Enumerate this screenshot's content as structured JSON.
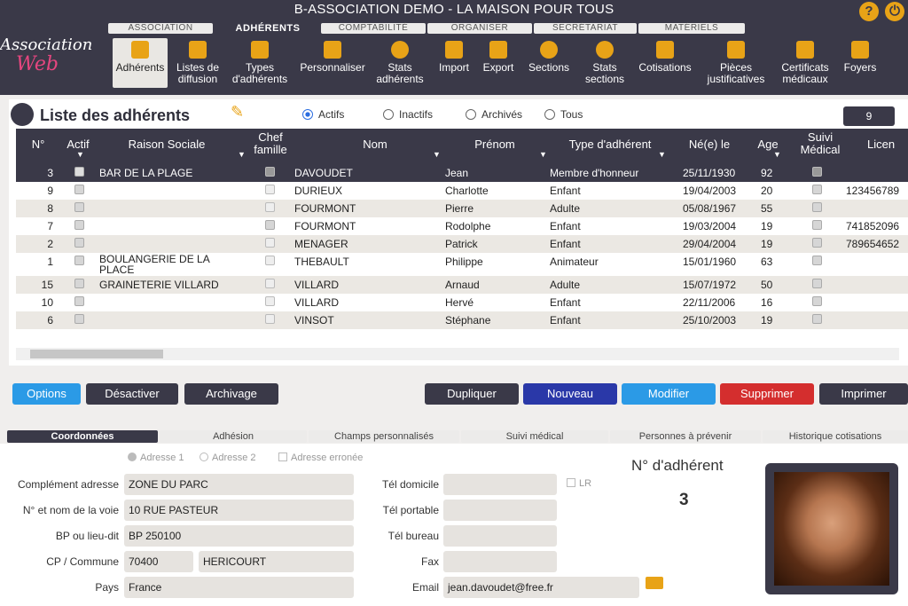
{
  "app": {
    "title": "B-ASSOCIATION DEMO - LA MAISON POUR TOUS",
    "logo_line1": "Association",
    "logo_line2": "Web",
    "help_icon": "?",
    "power_icon": "⏻"
  },
  "tabs": [
    "ASSOCIATION",
    "ADHÉRENTS",
    "COMPTABILITÉ",
    "ORGANISER",
    "SECRÉTARIAT",
    "MATÉRIELS"
  ],
  "toolbar": [
    "Adhérents",
    "Listes de diffusion",
    "Types d'adhérents",
    "Personnaliser",
    "Stats adhérents",
    "Import",
    "Export",
    "Sections",
    "Stats sections",
    "Cotisations",
    "Pièces justificatives",
    "Certificats médicaux",
    "Foyers"
  ],
  "list": {
    "title": "Liste des adhérents",
    "filters": [
      "Actifs",
      "Inactifs",
      "Archivés",
      "Tous"
    ],
    "selected_filter": "Actifs",
    "count": "9"
  },
  "columns": [
    "N°",
    "Actif",
    "Raison Sociale",
    "Chef famille",
    "Nom",
    "Prénom",
    "Type d'adhérent",
    "Né(e) le",
    "Age",
    "Suivi Médical",
    "Licen"
  ],
  "rows": [
    {
      "n": "3",
      "actif": true,
      "raison": "BAR DE LA PLAGE",
      "chef": false,
      "nom": "DAVOUDET",
      "prenom": "Jean",
      "type": "Membre d'honneur",
      "ne": "25/11/1930",
      "age": "92",
      "suivi": false,
      "licence": ""
    },
    {
      "n": "9",
      "actif": true,
      "raison": "",
      "chef": false,
      "nom": "DURIEUX",
      "prenom": "Charlotte",
      "type": "Enfant",
      "ne": "19/04/2003",
      "age": "20",
      "suivi": true,
      "licence": "123456789"
    },
    {
      "n": "8",
      "actif": true,
      "raison": "",
      "chef": false,
      "nom": "FOURMONT",
      "prenom": "Pierre",
      "type": "Adulte",
      "ne": "05/08/1967",
      "age": "55",
      "suivi": true,
      "licence": ""
    },
    {
      "n": "7",
      "actif": true,
      "raison": "",
      "chef": true,
      "nom": "FOURMONT",
      "prenom": "Rodolphe",
      "type": "Enfant",
      "ne": "19/03/2004",
      "age": "19",
      "suivi": true,
      "licence": "741852096"
    },
    {
      "n": "2",
      "actif": true,
      "raison": "",
      "chef": false,
      "nom": "MENAGER",
      "prenom": "Patrick",
      "type": "Enfant",
      "ne": "29/04/2004",
      "age": "19",
      "suivi": true,
      "licence": "789654652"
    },
    {
      "n": "1",
      "actif": true,
      "raison": "BOULANGERIE DE LA PLACE",
      "chef": false,
      "nom": "THEBAULT",
      "prenom": "Philippe",
      "type": "Animateur",
      "ne": "15/01/1960",
      "age": "63",
      "suivi": true,
      "licence": ""
    },
    {
      "n": "15",
      "actif": true,
      "raison": "GRAINETERIE VILLARD",
      "chef": false,
      "nom": "VILLARD",
      "prenom": "Arnaud",
      "type": "Adulte",
      "ne": "15/07/1972",
      "age": "50",
      "suivi": true,
      "licence": ""
    },
    {
      "n": "10",
      "actif": true,
      "raison": "",
      "chef": false,
      "nom": "VILLARD",
      "prenom": "Hervé",
      "type": "Enfant",
      "ne": "22/11/2006",
      "age": "16",
      "suivi": true,
      "licence": ""
    },
    {
      "n": "6",
      "actif": true,
      "raison": "",
      "chef": false,
      "nom": "VINSOT",
      "prenom": "Stéphane",
      "type": "Enfant",
      "ne": "25/10/2003",
      "age": "19",
      "suivi": true,
      "licence": ""
    }
  ],
  "buttons": {
    "options": "Options",
    "desactiver": "Désactiver",
    "archivage": "Archivage",
    "dupliquer": "Dupliquer",
    "nouveau": "Nouveau",
    "modifier": "Modifier",
    "supprimer": "Supprimer",
    "imprimer": "Imprimer"
  },
  "detail_tabs": [
    "Coordonnées",
    "Adhésion",
    "Champs personnalisés",
    "Suivi médical",
    "Personnes à prévenir",
    "Historique cotisations"
  ],
  "address": {
    "adresse1": "Adresse 1",
    "adresse2": "Adresse 2",
    "erronee": "Adresse erronée",
    "lr": "LR"
  },
  "labels": {
    "complement": "Complément adresse",
    "voie": "N° et nom de la voie",
    "bp": "BP ou lieu-dit",
    "cp": "CP / Commune",
    "pays": "Pays",
    "tel_dom": "Tél domicile",
    "tel_port": "Tél portable",
    "tel_bur": "Tél bureau",
    "fax": "Fax",
    "email": "Email",
    "num_adherent": "N° d'adhérent"
  },
  "values": {
    "complement": "ZONE DU PARC",
    "voie": "10 RUE PASTEUR",
    "bp": "BP 250100",
    "cp": "70400",
    "commune": "HERICOURT",
    "pays": "France",
    "tel_dom": "",
    "tel_port": "",
    "tel_bur": "",
    "fax": "",
    "email": "jean.davoudet@free.fr",
    "num_adherent": "3"
  },
  "colors": {
    "dark": "#3a3948",
    "accent": "#e8a317",
    "blue": "#2b9ae6",
    "navy": "#2a38a8",
    "red": "#d42e2e"
  }
}
